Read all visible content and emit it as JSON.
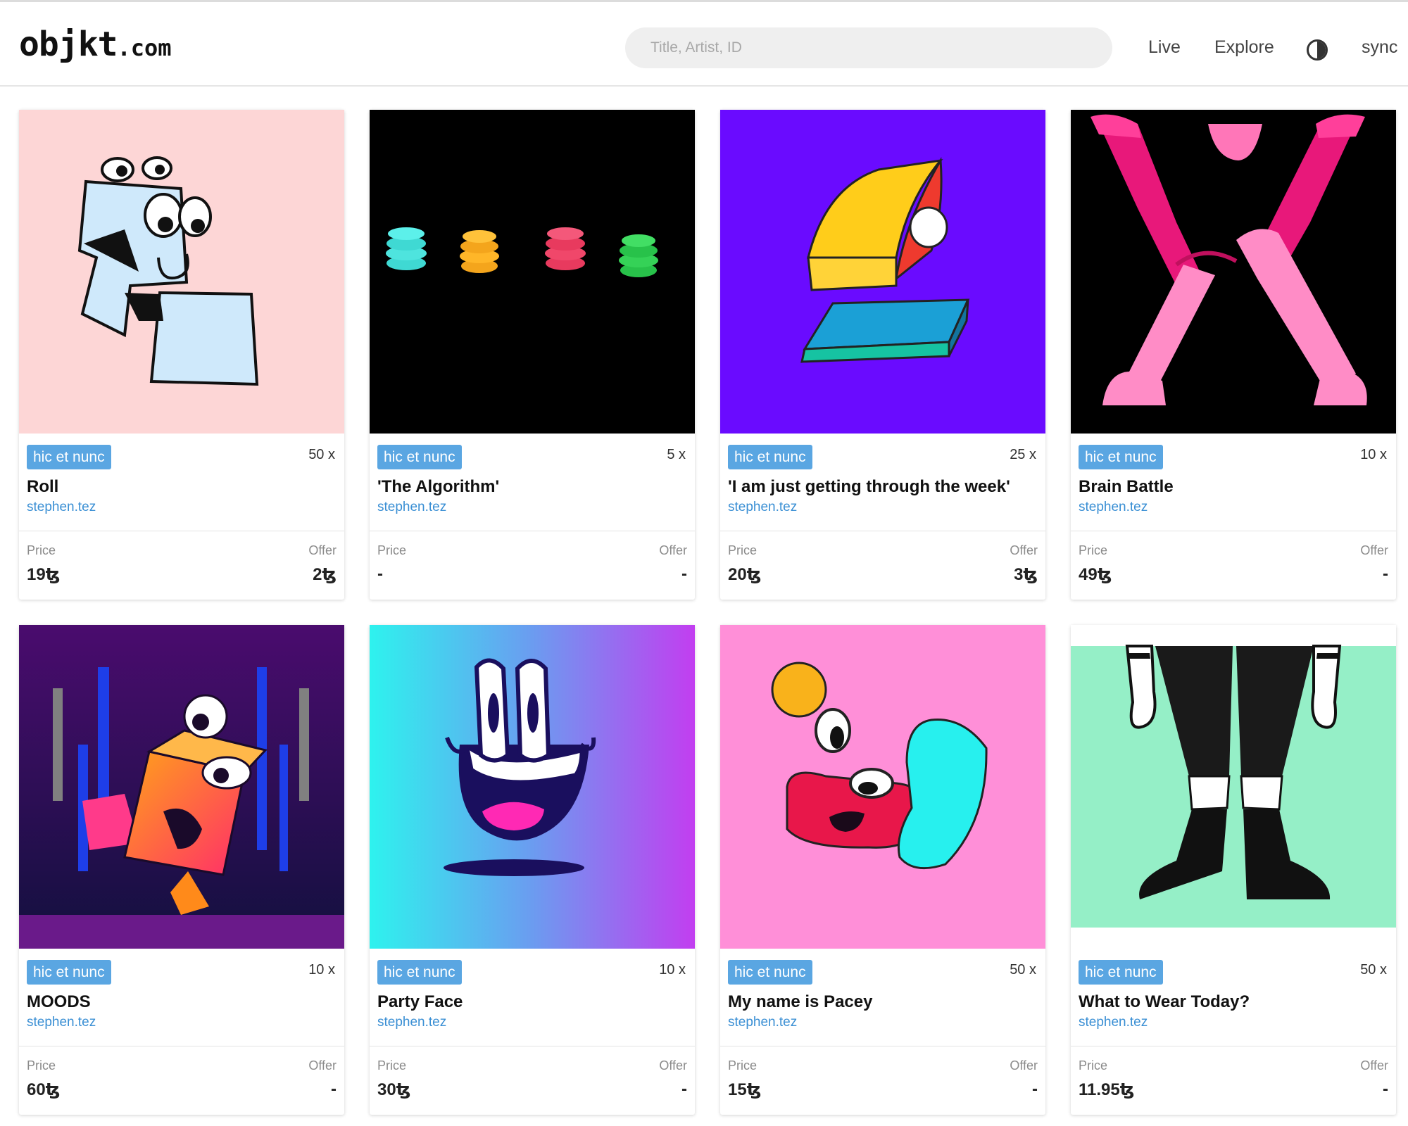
{
  "header": {
    "logo_main": "objkt",
    "logo_suffix": ".com",
    "search_placeholder": "Title, Artist, ID",
    "nav_live": "Live",
    "nav_explore": "Explore",
    "theme_icon": "contrast-icon",
    "nav_sync": "sync"
  },
  "cards": [
    {
      "platform": "hic et nunc",
      "editions": "50 x",
      "title": "Roll",
      "artist": "stephen.tez",
      "price_label": "Price",
      "offer_label": "Offer",
      "price": "19ꜩ",
      "offer": "2ꜩ",
      "bg": "#fdd6d6"
    },
    {
      "platform": "hic et nunc",
      "editions": "5 x",
      "title": "'The Algorithm'",
      "artist": "stephen.tez",
      "price_label": "Price",
      "offer_label": "Offer",
      "price": "-",
      "offer": "-",
      "bg": "#000000"
    },
    {
      "platform": "hic et nunc",
      "editions": "25 x",
      "title": "'I am just getting through the week'",
      "artist": "stephen.tez",
      "price_label": "Price",
      "offer_label": "Offer",
      "price": "20ꜩ",
      "offer": "3ꜩ",
      "bg": "#6a0bff"
    },
    {
      "platform": "hic et nunc",
      "editions": "10 x",
      "title": "Brain Battle",
      "artist": "stephen.tez",
      "price_label": "Price",
      "offer_label": "Offer",
      "price": "49ꜩ",
      "offer": "-",
      "bg": "#000000"
    },
    {
      "platform": "hic et nunc",
      "editions": "10 x",
      "title": "MOODS",
      "artist": "stephen.tez",
      "price_label": "Price",
      "offer_label": "Offer",
      "price": "60ꜩ",
      "offer": "-",
      "bg": "#2a0a4e"
    },
    {
      "platform": "hic et nunc",
      "editions": "10 x",
      "title": "Party Face",
      "artist": "stephen.tez",
      "price_label": "Price",
      "offer_label": "Offer",
      "price": "30ꜩ",
      "offer": "-",
      "bg": "#2ee9ee"
    },
    {
      "platform": "hic et nunc",
      "editions": "50 x",
      "title": "My name is Pacey",
      "artist": "stephen.tez",
      "price_label": "Price",
      "offer_label": "Offer",
      "price": "15ꜩ",
      "offer": "-",
      "bg": "#ff8fd8"
    },
    {
      "platform": "hic et nunc",
      "editions": "50 x",
      "title": "What to Wear Today?",
      "artist": "stephen.tez",
      "price_label": "Price",
      "offer_label": "Offer",
      "price": "11.95ꜩ",
      "offer": "-",
      "bg": "#95efc7"
    }
  ]
}
